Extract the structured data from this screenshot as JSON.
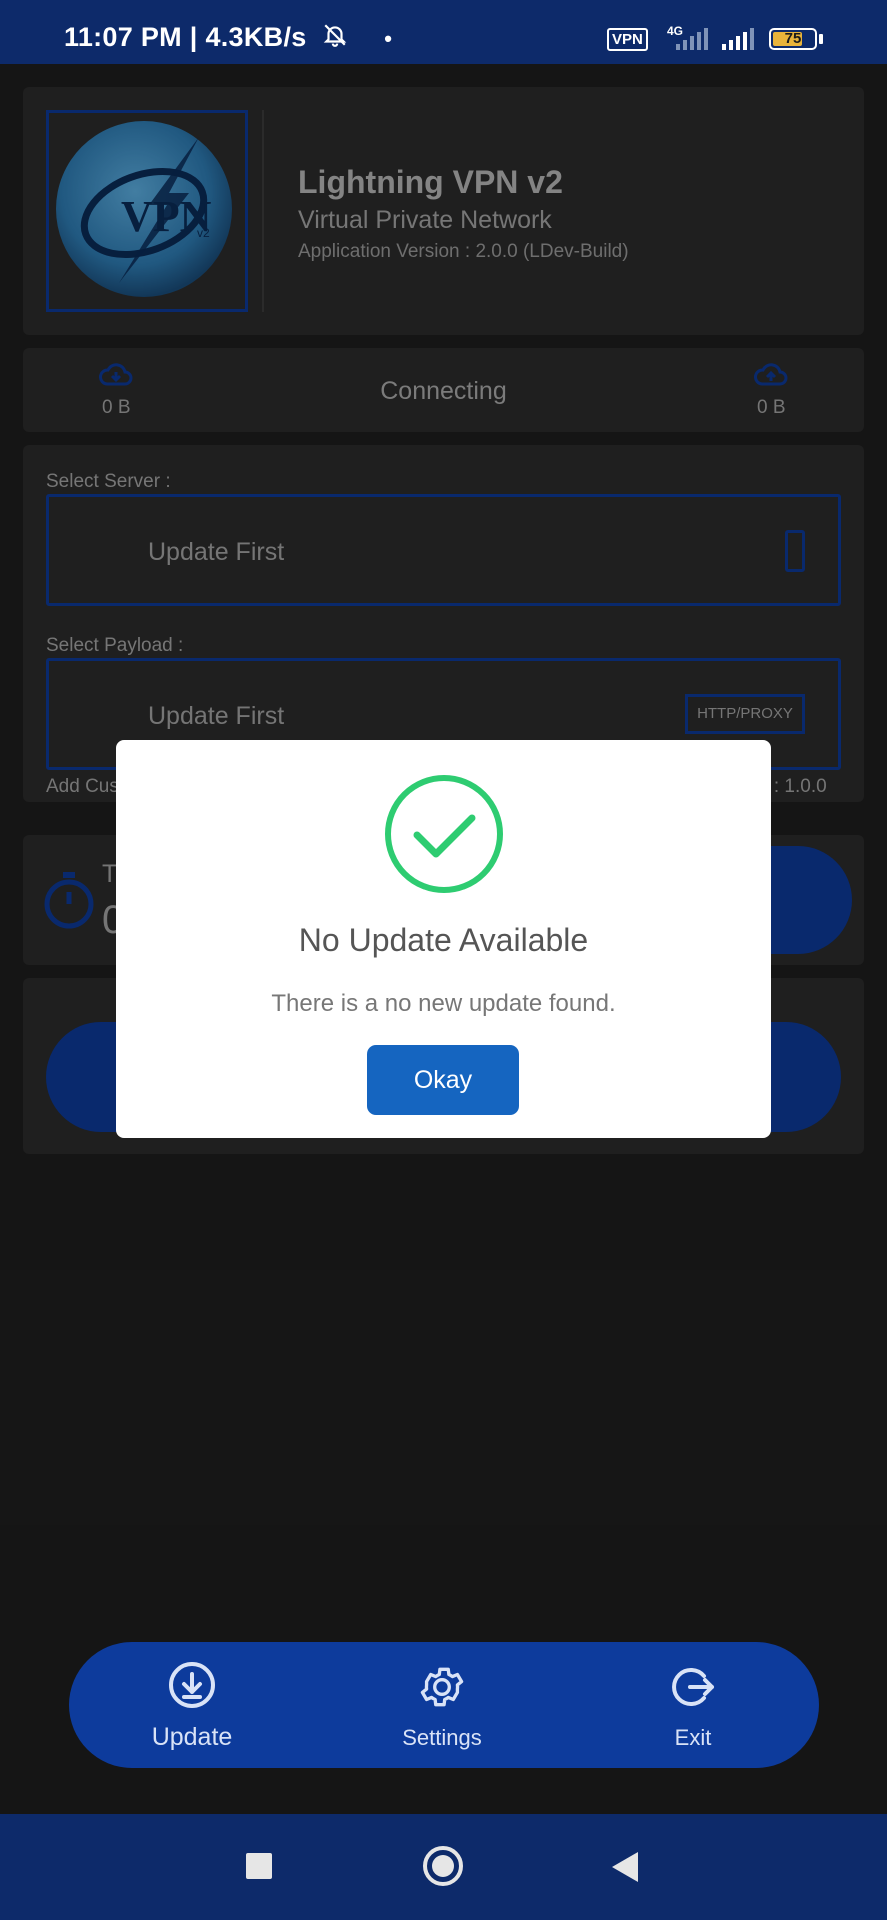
{
  "status_bar": {
    "time": "11:07 PM",
    "speed": "4.3KB/s",
    "vpn_badge": "VPN",
    "network": "4G",
    "battery": "75",
    "battery_level": 0.75
  },
  "header": {
    "logo_text": "VPN",
    "title": "Lightning VPN v2",
    "subtitle": "Virtual Private Network",
    "version": "Application Version : 2.0.0 (LDev-Build)"
  },
  "traffic": {
    "download": "0 B",
    "upload": "0 B",
    "status": "Connecting"
  },
  "server": {
    "label": "Select Server :",
    "value": "Update First"
  },
  "payload": {
    "label": "Select Payload :",
    "value": "Update First",
    "type": "HTTP/PROXY"
  },
  "custom": {
    "add_label_partial": "Add Cus",
    "version_partial": "n : 1.0.0"
  },
  "timer": {
    "label_partial": "T",
    "value_partial": "0"
  },
  "dialog": {
    "title": "No Update Available",
    "message": "There is a no new update found.",
    "button": "Okay"
  },
  "bottom_nav": {
    "update": "Update",
    "settings": "Settings",
    "exit": "Exit"
  },
  "colors": {
    "status_bar": "#0d2a6a",
    "accent_blue": "#0d3b9c",
    "dialog_button": "#1565c0",
    "success_green": "#2ecc71"
  }
}
